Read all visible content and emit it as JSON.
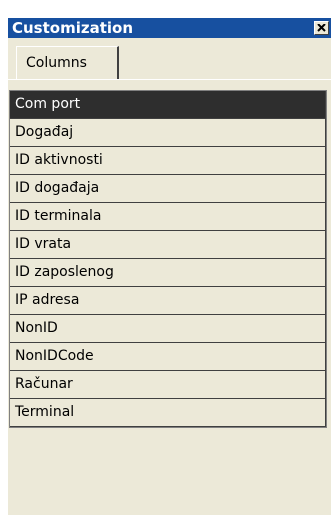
{
  "window": {
    "title": "Customization",
    "close_label": "x"
  },
  "tabs": [
    {
      "label": "Columns",
      "active": true
    }
  ],
  "columns": [
    {
      "label": "Com port",
      "selected": true
    },
    {
      "label": "Događaj",
      "selected": false
    },
    {
      "label": "ID aktivnosti",
      "selected": false
    },
    {
      "label": "ID događaja",
      "selected": false
    },
    {
      "label": "ID terminala",
      "selected": false
    },
    {
      "label": "ID vrata",
      "selected": false
    },
    {
      "label": "ID zaposlenog",
      "selected": false
    },
    {
      "label": "IP adresa",
      "selected": false
    },
    {
      "label": "NonID",
      "selected": false
    },
    {
      "label": "NonIDCode",
      "selected": false
    },
    {
      "label": "Računar",
      "selected": false
    },
    {
      "label": "Terminal",
      "selected": false
    }
  ],
  "colors": {
    "titlebar": "#1750a0",
    "selected_row": "#2e2e2e",
    "panel": "#ece9d8"
  }
}
